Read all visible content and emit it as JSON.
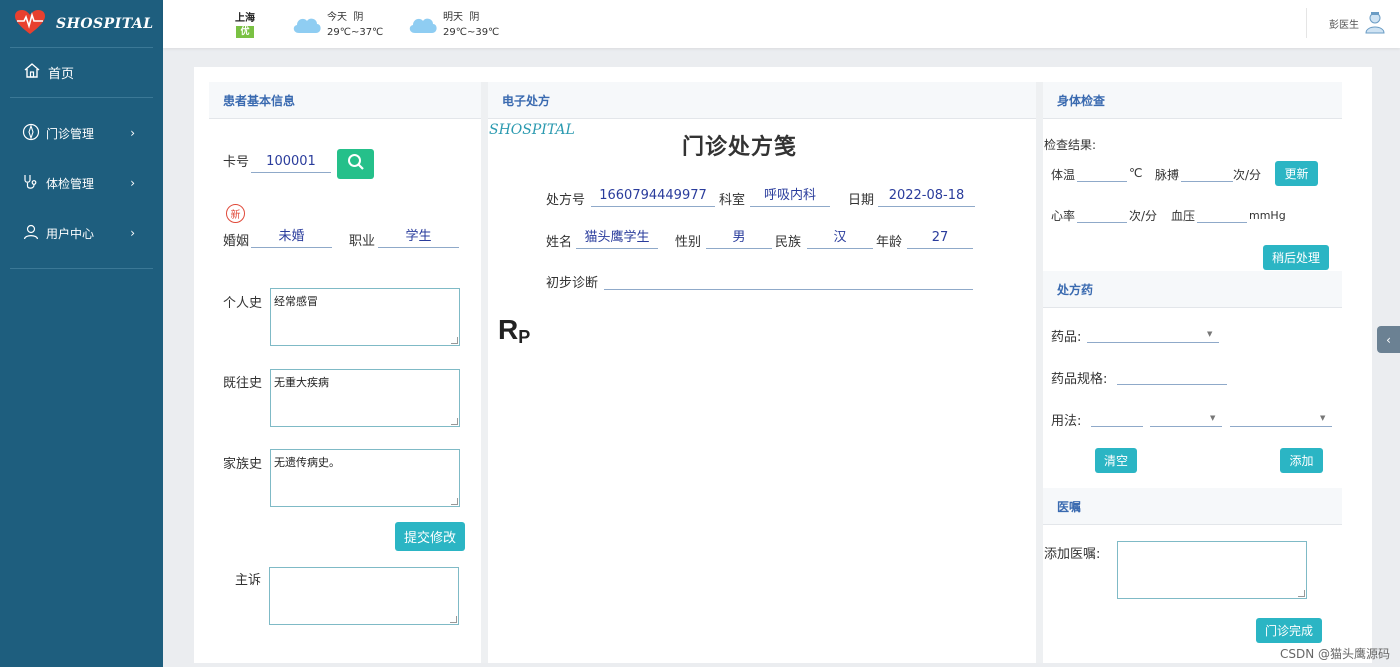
{
  "app": {
    "logo_text": "SHOSPITAL"
  },
  "sidebar": {
    "home_label": "首页",
    "items": [
      {
        "label": "门诊管理"
      },
      {
        "label": "体检管理"
      },
      {
        "label": "用户中心"
      }
    ]
  },
  "header": {
    "city": "上海",
    "aqi": "优",
    "today": {
      "label": "今天",
      "weather": "阴",
      "temp": "29℃~37℃"
    },
    "tomorrow": {
      "label": "明天",
      "weather": "阴",
      "temp": "29℃~39℃"
    },
    "user": "彭医生"
  },
  "patient": {
    "title": "患者基本信息",
    "card_label": "卡号",
    "card_value": "100001",
    "new_badge": "新",
    "marital_label": "婚姻",
    "marital_value": "未婚",
    "job_label": "职业",
    "job_value": "学生",
    "personal_label": "个人史",
    "personal_value": "经常感冒",
    "past_label": "既往史",
    "past_value": "无重大疾病",
    "family_label": "家族史",
    "family_value": "无遗传病史。",
    "submit_label": "提交修改",
    "complaint_label": "主诉",
    "complaint_value": ""
  },
  "prescription": {
    "title": "电子处方",
    "mark": "SHOSPITAL",
    "heading": "门诊处方笺",
    "no_label": "处方号",
    "no_value": "1660794449977",
    "dept_label": "科室",
    "dept_value": "呼吸内科",
    "date_label": "日期",
    "date_value": "2022-08-18",
    "name_label": "姓名",
    "name_value": "猫头鹰学生",
    "sex_label": "性别",
    "sex_value": "男",
    "nation_label": "民族",
    "nation_value": "汉",
    "age_label": "年龄",
    "age_value": "27",
    "diag_label": "初步诊断",
    "diag_value": "",
    "rp_main": "R",
    "rp_sub": "P"
  },
  "exam": {
    "title": "身体检查",
    "result_label": "检查结果:",
    "temp_label": "体温",
    "temp_unit": "℃",
    "pulse_label": "脉搏",
    "pulse_unit": "次/分",
    "update_label": "更新",
    "heart_label": "心率",
    "heart_unit": "次/分",
    "bp_label": "血压",
    "bp_unit": "mmHg",
    "later_label": "稍后处理"
  },
  "drug": {
    "title": "处方药",
    "drug_label": "药品:",
    "spec_label": "药品规格:",
    "usage_label": "用法:",
    "clear_label": "清空",
    "add_label": "添加"
  },
  "advice": {
    "title": "医嘱",
    "add_label": "添加医嘱:",
    "value": "",
    "done_label": "门诊完成"
  },
  "watermark": "CSDN @猫头鹰源码"
}
